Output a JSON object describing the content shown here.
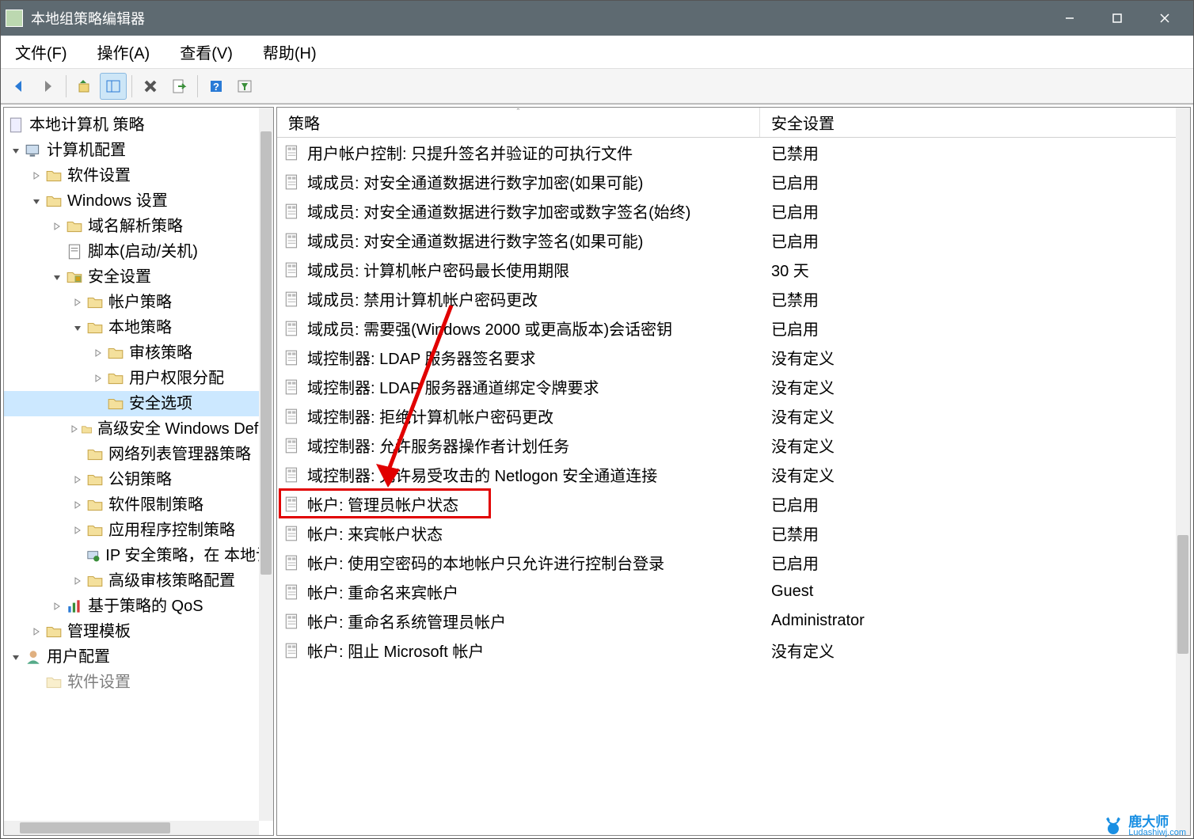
{
  "title": "本地组策略编辑器",
  "menubar": {
    "file": "文件(F)",
    "action": "操作(A)",
    "view": "查看(V)",
    "help": "帮助(H)"
  },
  "tree": {
    "root": "本地计算机 策略",
    "computer_config": "计算机配置",
    "software_settings": "软件设置",
    "windows_settings": "Windows 设置",
    "dns_policy": "域名解析策略",
    "scripts": "脚本(启动/关机)",
    "security_settings": "安全设置",
    "account_policies": "帐户策略",
    "local_policies": "本地策略",
    "audit_policy": "审核策略",
    "user_rights": "用户权限分配",
    "security_options": "安全选项",
    "advanced_windows": "高级安全 Windows Defender 防火墙",
    "network_list": "网络列表管理器策略",
    "public_key": "公钥策略",
    "software_restriction": "软件限制策略",
    "app_control": "应用程序控制策略",
    "ip_security": "IP 安全策略，在 本地计算机",
    "advanced_audit": "高级审核策略配置",
    "policy_qos": "基于策略的 QoS",
    "admin_templates": "管理模板",
    "user_config": "用户配置",
    "user_software": "软件设置"
  },
  "list": {
    "header_policy": "策略",
    "header_setting": "安全设置",
    "rows": [
      {
        "policy": "用户帐户控制: 只提升签名并验证的可执行文件",
        "setting": "已禁用"
      },
      {
        "policy": "域成员: 对安全通道数据进行数字加密(如果可能)",
        "setting": "已启用"
      },
      {
        "policy": "域成员: 对安全通道数据进行数字加密或数字签名(始终)",
        "setting": "已启用"
      },
      {
        "policy": "域成员: 对安全通道数据进行数字签名(如果可能)",
        "setting": "已启用"
      },
      {
        "policy": "域成员: 计算机帐户密码最长使用期限",
        "setting": "30 天"
      },
      {
        "policy": "域成员: 禁用计算机帐户密码更改",
        "setting": "已禁用"
      },
      {
        "policy": "域成员: 需要强(Windows 2000 或更高版本)会话密钥",
        "setting": "已启用"
      },
      {
        "policy": "域控制器: LDAP 服务器签名要求",
        "setting": "没有定义"
      },
      {
        "policy": "域控制器: LDAP 服务器通道绑定令牌要求",
        "setting": "没有定义"
      },
      {
        "policy": "域控制器: 拒绝计算机帐户密码更改",
        "setting": "没有定义"
      },
      {
        "policy": "域控制器: 允许服务器操作者计划任务",
        "setting": "没有定义"
      },
      {
        "policy": "域控制器: 允许易受攻击的 Netlogon 安全通道连接",
        "setting": "没有定义"
      },
      {
        "policy": "帐户: 管理员帐户状态",
        "setting": "已启用"
      },
      {
        "policy": "帐户: 来宾帐户状态",
        "setting": "已禁用"
      },
      {
        "policy": "帐户: 使用空密码的本地帐户只允许进行控制台登录",
        "setting": "已启用"
      },
      {
        "policy": "帐户: 重命名来宾帐户",
        "setting": "Guest"
      },
      {
        "policy": "帐户: 重命名系统管理员帐户",
        "setting": "Administrator"
      },
      {
        "policy": "帐户: 阻止 Microsoft 帐户",
        "setting": "没有定义"
      }
    ]
  },
  "watermark": {
    "brand": "鹿大师",
    "url": "Ludashiwj.com"
  }
}
